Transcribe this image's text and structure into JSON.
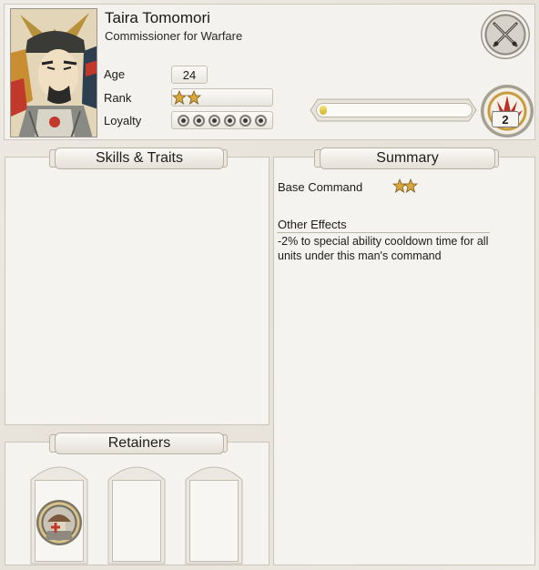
{
  "character": {
    "name": "Taira Tomomori",
    "title": "Commissioner for Warfare",
    "portrait_icon": "samurai-portrait"
  },
  "stats": {
    "age_label": "Age",
    "age_value": "24",
    "rank_label": "Rank",
    "rank_stars": 2,
    "loyalty_label": "Loyalty",
    "loyalty_pips": 6
  },
  "experience": {
    "progress": 0.05,
    "rank_number": "2"
  },
  "panels": {
    "skills_title": "Skills & Traits",
    "summary_title": "Summary",
    "retainers_title": "Retainers"
  },
  "summary": {
    "base_command_label": "Base Command",
    "base_command_stars": 2,
    "other_effects_label": "Other Effects",
    "effect_text": "-2% to special ability cooldown time for all units under this man's command"
  },
  "retainers": [
    {
      "icon": "armoured-retainer-icon",
      "filled": true
    },
    {
      "icon": "",
      "filled": false
    },
    {
      "icon": "",
      "filled": false
    }
  ],
  "colors": {
    "star_gold": "#d9a93a",
    "xp_fill": "#e6c84a",
    "emblem_red": "#b8332a"
  }
}
